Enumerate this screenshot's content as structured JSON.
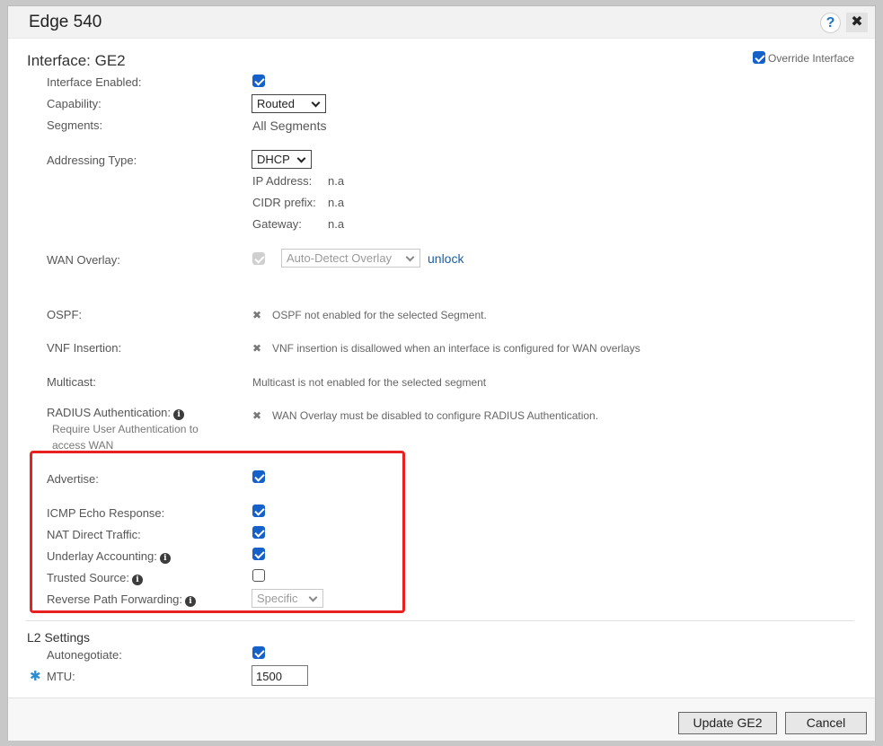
{
  "dialog": {
    "title": "Edge 540",
    "help_glyph": "?",
    "close_glyph": "✖"
  },
  "interface": {
    "heading": "Interface: GE2",
    "override_label": "Override Interface",
    "override_checked": true
  },
  "fields": {
    "interface_enabled": {
      "label": "Interface Enabled:",
      "checked": true
    },
    "capability": {
      "label": "Capability:",
      "value": "Routed"
    },
    "segments": {
      "label": "Segments:",
      "value": "All Segments"
    },
    "addressing_type": {
      "label": "Addressing Type:",
      "value": "DHCP"
    },
    "ip_address": {
      "label": "IP Address:",
      "value": "n.a"
    },
    "cidr_prefix": {
      "label": "CIDR prefix:",
      "value": "n.a"
    },
    "gateway": {
      "label": "Gateway:",
      "value": "n.a"
    },
    "wan_overlay": {
      "label": "WAN Overlay:",
      "checked": true,
      "disabled": true,
      "value": "Auto-Detect Overlay",
      "unlock": "unlock"
    },
    "ospf": {
      "label": "OSPF:",
      "note": "OSPF not enabled for the selected Segment."
    },
    "vnf_insertion": {
      "label": "VNF Insertion:",
      "note": "VNF insertion is disallowed when an interface is configured for WAN overlays"
    },
    "multicast": {
      "label": "Multicast:",
      "note": "Multicast is not enabled for the selected segment"
    },
    "radius": {
      "label": "RADIUS Authentication:",
      "sub": "Require User Authentication to access WAN",
      "note": "WAN Overlay must be disabled to configure RADIUS Authentication."
    },
    "advertise": {
      "label": "Advertise:",
      "checked": true
    },
    "icmp_echo": {
      "label": "ICMP Echo Response:",
      "checked": true
    },
    "nat_direct": {
      "label": "NAT Direct Traffic:",
      "checked": true
    },
    "underlay_accounting": {
      "label": "Underlay Accounting:",
      "checked": true
    },
    "trusted_source": {
      "label": "Trusted Source:",
      "checked": false
    },
    "rpf": {
      "label": "Reverse Path Forwarding:",
      "value": "Specific"
    }
  },
  "l2": {
    "heading": "L2 Settings",
    "autonegotiate": {
      "label": "Autonegotiate:",
      "checked": true
    },
    "mtu": {
      "label": "MTU:",
      "value": "1500",
      "required_glyph": "✱"
    }
  },
  "buttons": {
    "update": "Update GE2",
    "cancel": "Cancel"
  },
  "icons": {
    "x_glyph": "✖",
    "info_glyph": "i"
  },
  "colors": {
    "accent": "#1560c9",
    "highlight": "#e8201f",
    "link": "#1a5fa8"
  }
}
